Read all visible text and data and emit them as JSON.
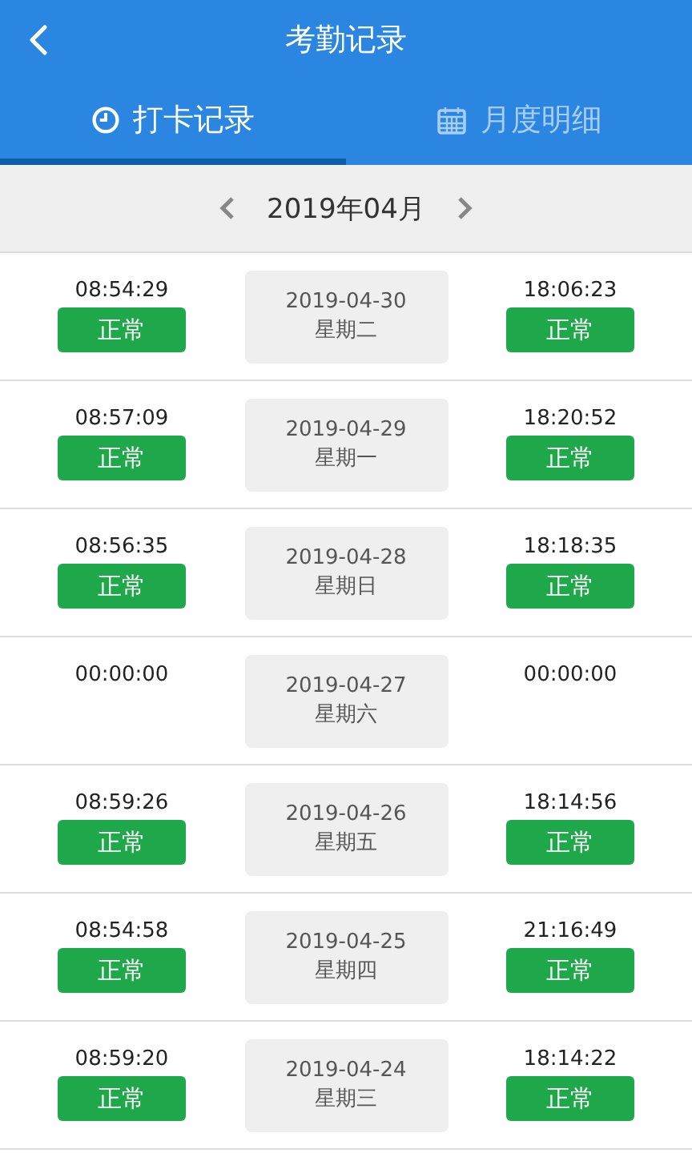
{
  "header": {
    "title": "考勤记录"
  },
  "tabs": [
    {
      "label": "打卡记录",
      "kind": "clock",
      "selected": true
    },
    {
      "label": "月度明细",
      "kind": "calendar",
      "selected": false
    }
  ],
  "month": {
    "label": "2019年04月"
  },
  "records": [
    {
      "in_time": "08:54:29",
      "in_status": "正常",
      "date": "2019-04-30",
      "weekday": "星期二",
      "out_time": "18:06:23",
      "out_status": "正常"
    },
    {
      "in_time": "08:57:09",
      "in_status": "正常",
      "date": "2019-04-29",
      "weekday": "星期一",
      "out_time": "18:20:52",
      "out_status": "正常"
    },
    {
      "in_time": "08:56:35",
      "in_status": "正常",
      "date": "2019-04-28",
      "weekday": "星期日",
      "out_time": "18:18:35",
      "out_status": "正常"
    },
    {
      "in_time": "00:00:00",
      "date": "2019-04-27",
      "weekday": "星期六",
      "out_time": "00:00:00"
    },
    {
      "in_time": "08:59:26",
      "in_status": "正常",
      "date": "2019-04-26",
      "weekday": "星期五",
      "out_time": "18:14:56",
      "out_status": "正常"
    },
    {
      "in_time": "08:54:58",
      "in_status": "正常",
      "date": "2019-04-25",
      "weekday": "星期四",
      "out_time": "21:16:49",
      "out_status": "正常"
    },
    {
      "in_time": "08:59:20",
      "in_status": "正常",
      "date": "2019-04-24",
      "weekday": "星期三",
      "out_time": "18:14:22",
      "out_status": "正常"
    }
  ]
}
